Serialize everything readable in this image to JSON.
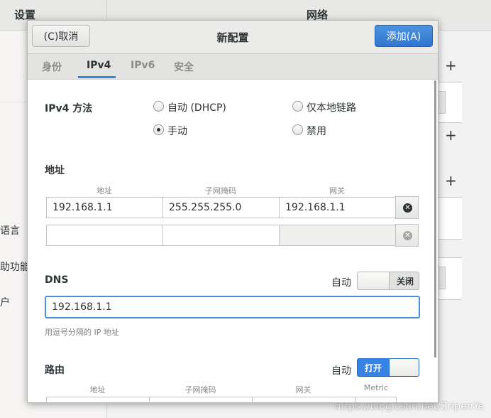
{
  "background": {
    "left_title": "设置",
    "right_title": "网络",
    "sidebar_items": [
      "语言",
      "助功能",
      "户"
    ]
  },
  "dialog": {
    "cancel_label": "(C)取消",
    "title": "新配置",
    "add_label": "添加(A)",
    "tabs": [
      {
        "label": "身份",
        "active": false
      },
      {
        "label": "IPv4",
        "active": true
      },
      {
        "label": "IPv6",
        "active": false
      },
      {
        "label": "安全",
        "active": false
      }
    ],
    "ipv4_method": {
      "label": "IPv4 方法",
      "options": [
        {
          "label": "自动 (DHCP)",
          "selected": false
        },
        {
          "label": "仅本地链路",
          "selected": false
        },
        {
          "label": "手动",
          "selected": true
        },
        {
          "label": "禁用",
          "selected": false
        }
      ]
    },
    "addresses": {
      "label": "地址",
      "columns": [
        "地址",
        "子网掩码",
        "网关"
      ],
      "rows": [
        {
          "address": "192.168.1.1",
          "netmask": "255.255.255.0",
          "gateway": "192.168.1.1"
        },
        {
          "address": "",
          "netmask": "",
          "gateway": ""
        }
      ]
    },
    "dns": {
      "label": "DNS",
      "auto_label": "自动",
      "switch_text": "关闭",
      "switch_on": false,
      "value": "192.168.1.1",
      "hint": "用逗号分隔的 IP 地址"
    },
    "routes": {
      "label": "路由",
      "auto_label": "自动",
      "switch_text": "打开",
      "switch_on": true,
      "columns": [
        "地址",
        "子网掩码",
        "网关",
        "Metric"
      ]
    }
  },
  "watermark": "https://blog.csdn.net/ZripenYe",
  "colors": {
    "accent": "#3584e4",
    "add_button": "#3a83d9"
  }
}
